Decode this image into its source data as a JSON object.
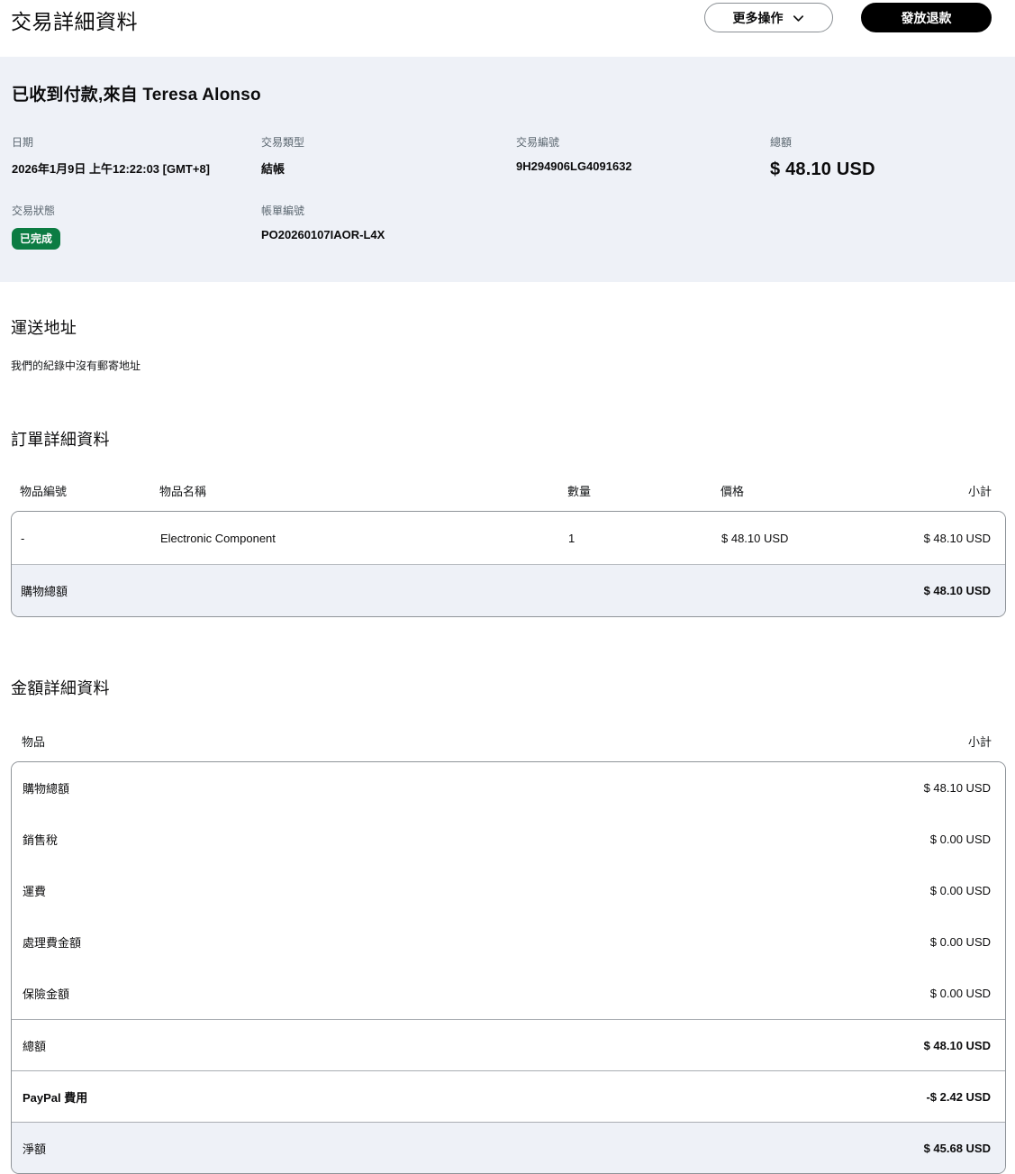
{
  "page": {
    "title": "交易詳細資料"
  },
  "header": {
    "more_actions_label": "更多操作",
    "refund_label": "發放退款"
  },
  "summary": {
    "heading": "已收到付款,來自 Teresa Alonso",
    "fields": [
      {
        "label": "日期",
        "value": "2026年1月9日 上午12:22:03 [GMT+8]"
      },
      {
        "label": "交易類型",
        "value": "結帳"
      },
      {
        "label": "交易編號",
        "value": "9H294906LG4091632"
      },
      {
        "label": "總額",
        "value": "$ 48.10 USD"
      },
      {
        "label": "交易狀態",
        "value": "已完成"
      },
      {
        "label": "帳單編號",
        "value": "PO20260107IAOR-L4X"
      }
    ]
  },
  "shipping": {
    "heading": "運送地址",
    "empty_text": "我們的紀錄中沒有郵寄地址"
  },
  "order": {
    "heading": "訂單詳細資料",
    "columns": {
      "item_number": "物品編號",
      "item_name": "物品名稱",
      "quantity": "數量",
      "price": "價格",
      "subtotal": "小計"
    },
    "rows": [
      {
        "item_number": "-",
        "item_name": "Electronic Component",
        "quantity": "1",
        "price": "$ 48.10 USD",
        "subtotal": "$ 48.10 USD"
      }
    ],
    "total": {
      "label": "購物總額",
      "value": "$ 48.10 USD"
    }
  },
  "amount": {
    "heading": "金額詳細資料",
    "columns": {
      "item": "物品",
      "subtotal": "小計"
    },
    "rows": [
      {
        "label": "購物總額",
        "value": "$ 48.10 USD"
      },
      {
        "label": "銷售稅",
        "value": "$ 0.00 USD"
      },
      {
        "label": "運費",
        "value": "$ 0.00 USD"
      },
      {
        "label": "處理費金額",
        "value": "$ 0.00 USD"
      },
      {
        "label": "保險金額",
        "value": "$ 0.00 USD"
      },
      {
        "label": "總額",
        "value": "$ 48.10 USD"
      },
      {
        "label": "PayPal 費用",
        "value": "-$ 2.42 USD"
      },
      {
        "label": "淨額",
        "value": "$ 45.68 USD"
      }
    ]
  },
  "colors": {
    "status_green": "#0c7c43",
    "panel_bg": "#eef1f7",
    "button_black": "#000000"
  }
}
